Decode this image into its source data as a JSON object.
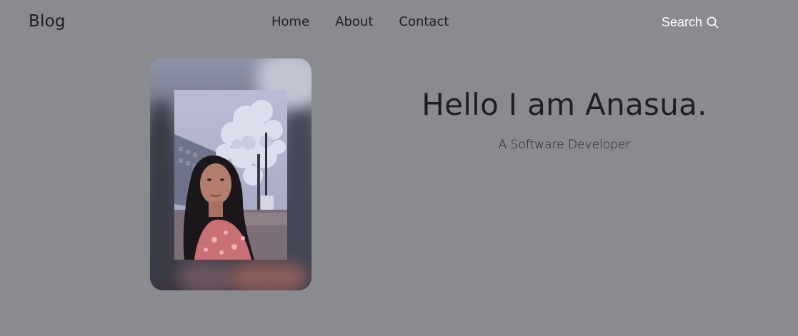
{
  "header": {
    "logo": "Blog",
    "nav": [
      {
        "label": "Home"
      },
      {
        "label": "About"
      },
      {
        "label": "Contact"
      }
    ],
    "search_label": "Search"
  },
  "hero": {
    "title": "Hello I am Anasua.",
    "subtitle": "A Software Developer"
  },
  "colors": {
    "background": "#898b90",
    "text": "#1d1f24",
    "search_text": "#ffffff"
  },
  "icons": {
    "search": "search-icon"
  }
}
